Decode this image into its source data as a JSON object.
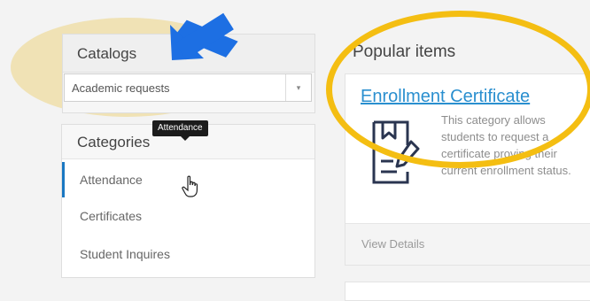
{
  "catalogs": {
    "title": "Catalogs",
    "selected_value": "Academic requests",
    "dropdown_arrow": "▾"
  },
  "categories": {
    "title": "Categories",
    "items": [
      {
        "label": "Attendance"
      },
      {
        "label": "Certificates"
      },
      {
        "label": "Student Inquires"
      }
    ]
  },
  "tooltip": {
    "text": "Attendance"
  },
  "popular": {
    "title": "Popular items",
    "item": {
      "title": "Enrollment Certificate",
      "description": "This category allows students to request a certificate proving their current enrollment status.",
      "icon": "document-edit-icon",
      "action_label": "View Details"
    }
  },
  "colors": {
    "accent": "#1a78c2",
    "link": "#2a8fcf",
    "annotation_yellow": "#f4be12",
    "annotation_arrow": "#1d6fe3"
  }
}
